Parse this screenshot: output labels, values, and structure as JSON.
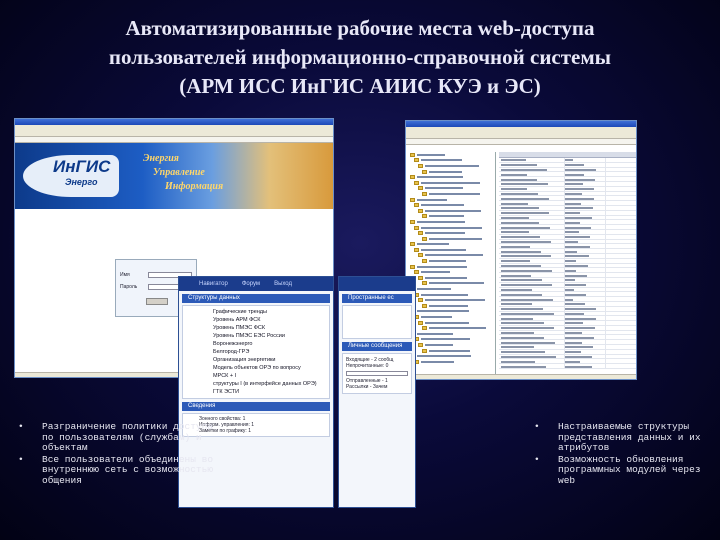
{
  "slide": {
    "title_lines": [
      "Автоматизированные рабочие места web-доступа",
      "пользователей информационно-справочной системы",
      "(АРМ ИСС ИнГИС АИИС КУЭ и ЭС)"
    ]
  },
  "window1": {
    "logo_main": "ИнГИС",
    "logo_sub": "Энерго",
    "tagline": [
      "Энергия",
      "Управление",
      "Информация"
    ],
    "login_labels": [
      "Имя",
      "Пароль"
    ]
  },
  "window2": {
    "nav": [
      "Навигатор",
      "Форум",
      "Выход"
    ],
    "panel_title": "Структуры данных",
    "items": [
      "Графические тренды",
      "Уровень АРМ ФСК",
      "Уровень ПМЭС ФСК",
      "Уровень ПМЭС ЕЭС России",
      "Воронежэнерго",
      "Белгород-ГРЭ",
      "Организация энергетики",
      "Модель объектов ОРЭ по вопросу",
      "МРСК + I",
      "структуры I (в интерфейсе данных ОРЭ)",
      "ГТК ЭСТИ"
    ],
    "panel2_title": "Сведения",
    "panel2_lines": [
      "Зонного свойства: 1",
      "Информ. управления: 1",
      "Заметки по графику: 1"
    ]
  },
  "window3": {
    "panel_title": "Пространные ес",
    "panel2_title": "Личные сообщения",
    "lines": [
      "Входящие - 2 сообщ",
      "Непрочитанные: 0",
      "Отправленные - 1",
      "Рассылки - Зачем"
    ]
  },
  "bullets_left": [
    "Разграничение политики доступа по пользователям (службам) и объектам",
    "Все пользователи объединены во внутреннюю сеть с возможностью общения"
  ],
  "bullets_right": [
    "Настраиваемые структуры представления данных и их атрибутов",
    "Возможность обновления программных модулей через web"
  ],
  "colors": {
    "background": "#0a0a3a",
    "title": "#e8e8f8",
    "bullet_text": "#e6e6f0",
    "nav_blue": "#1b3c8c"
  }
}
